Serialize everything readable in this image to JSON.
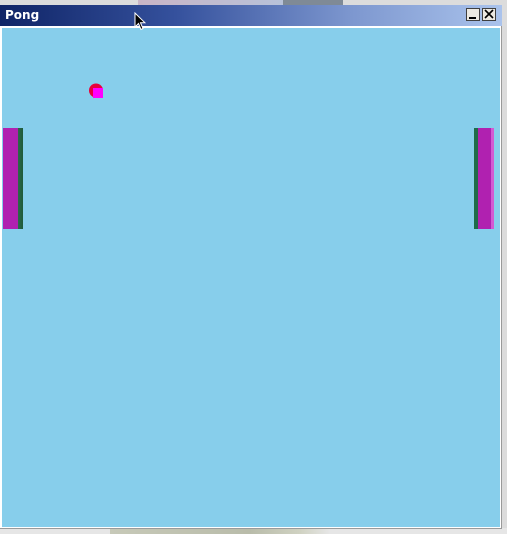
{
  "window": {
    "title": "Pong",
    "minimize_icon": "minimize-icon",
    "close_icon": "close-icon"
  },
  "game": {
    "background_color": "#87ceeb",
    "paddle_color": "#b021b0",
    "paddle_edge_color": "#1f6b4a",
    "ball_color": "#ff00ff",
    "ball_highlight_color": "#e8003a"
  }
}
